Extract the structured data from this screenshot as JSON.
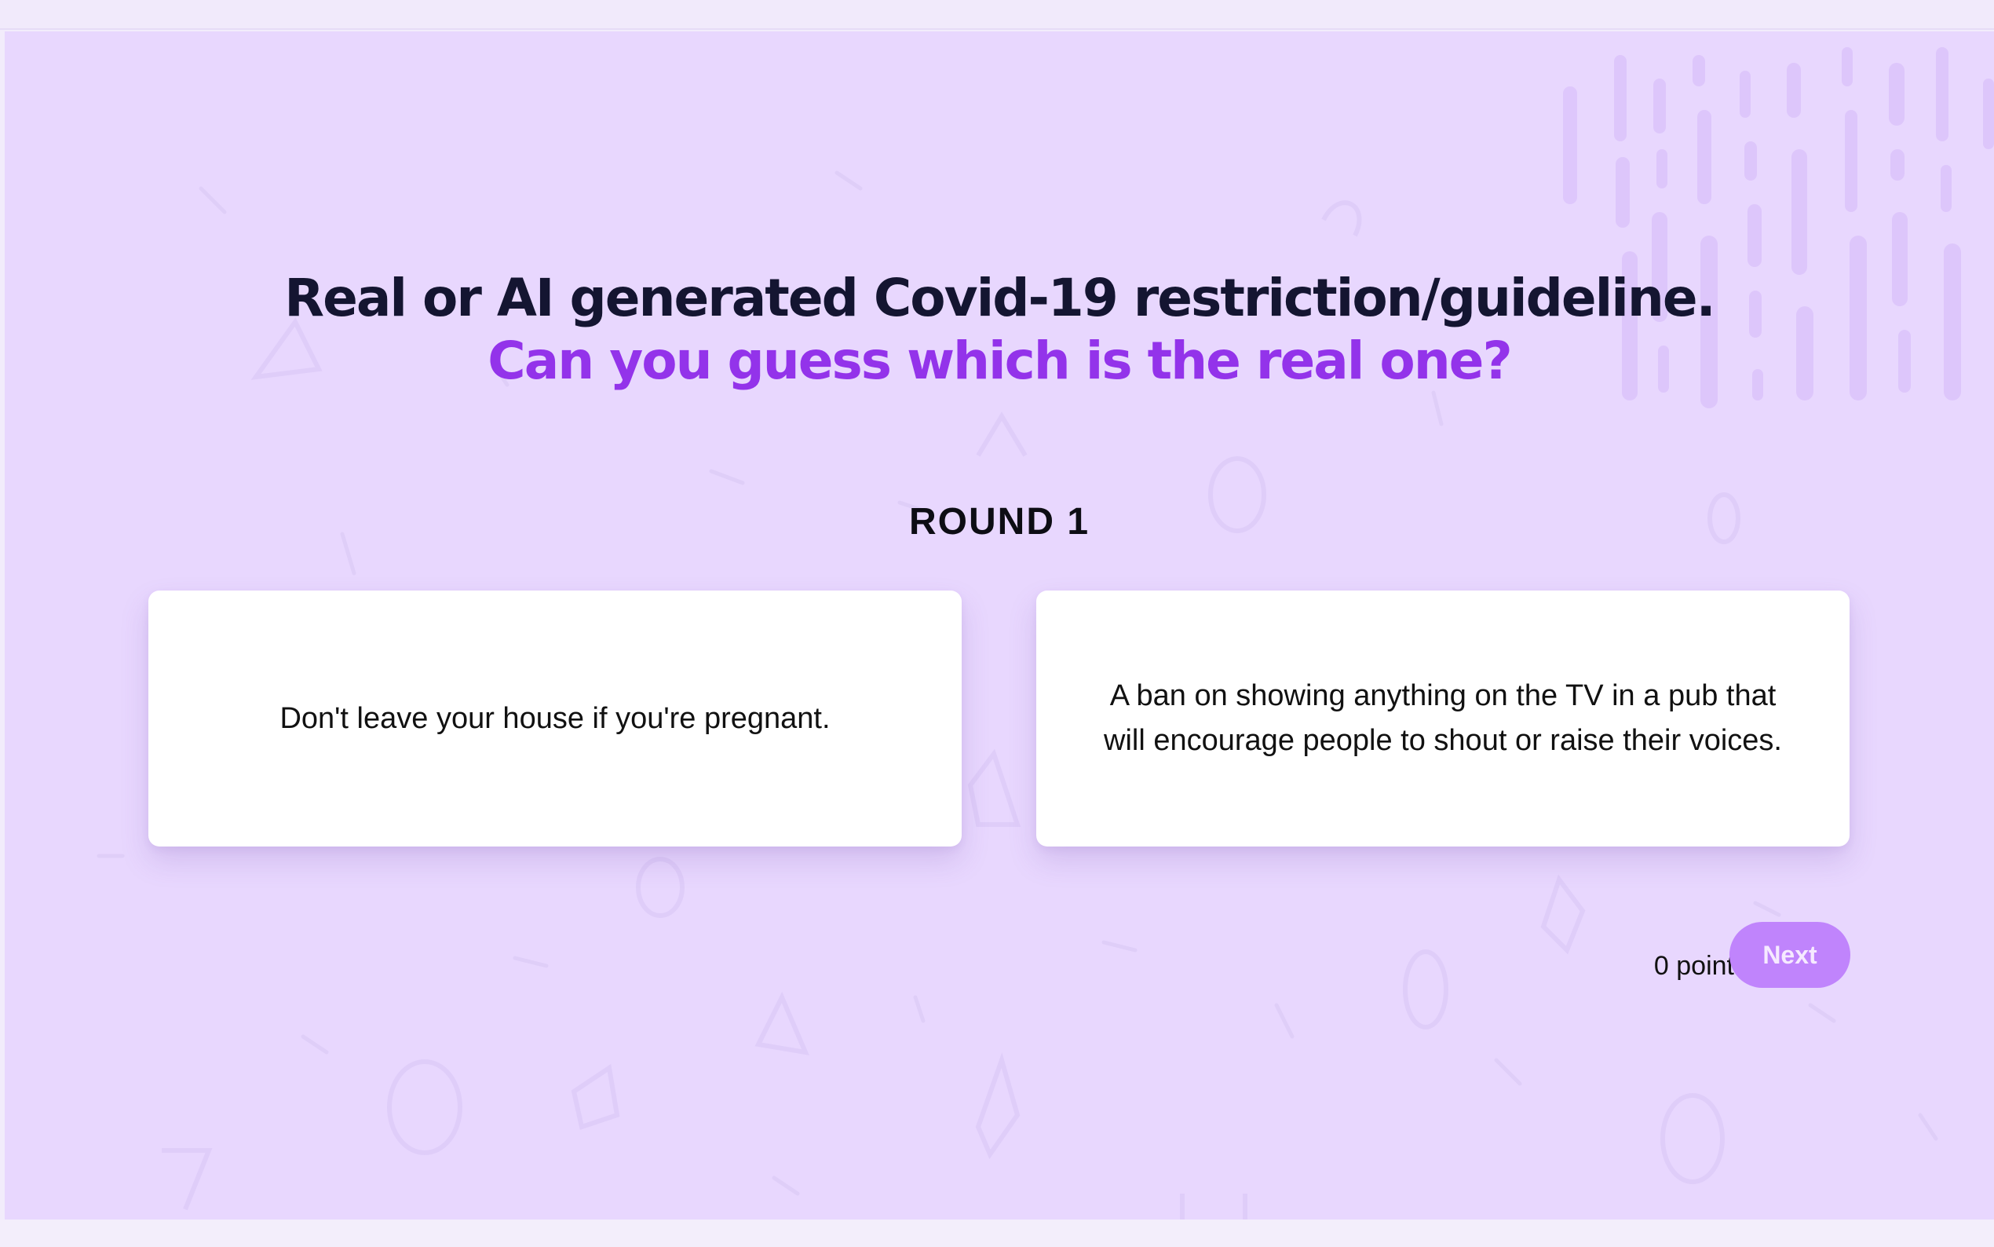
{
  "header": {
    "title": "Real or AI generated Covid-19 restriction/guideline.",
    "subtitle": "Can you guess which is the real one?"
  },
  "round": {
    "label": "ROUND 1"
  },
  "options": [
    {
      "text": "Don't leave your house if you're pregnant."
    },
    {
      "text": "A ban on showing anything on the TV in a pub that will encourage people to shout or raise their voices."
    }
  ],
  "footer": {
    "score_label": "0 points",
    "next_label": "Next"
  },
  "colors": {
    "background": "#e8d7fe",
    "title_text": "#141531",
    "accent": "#9333ea",
    "button": "#c084fc",
    "card": "#ffffff"
  }
}
